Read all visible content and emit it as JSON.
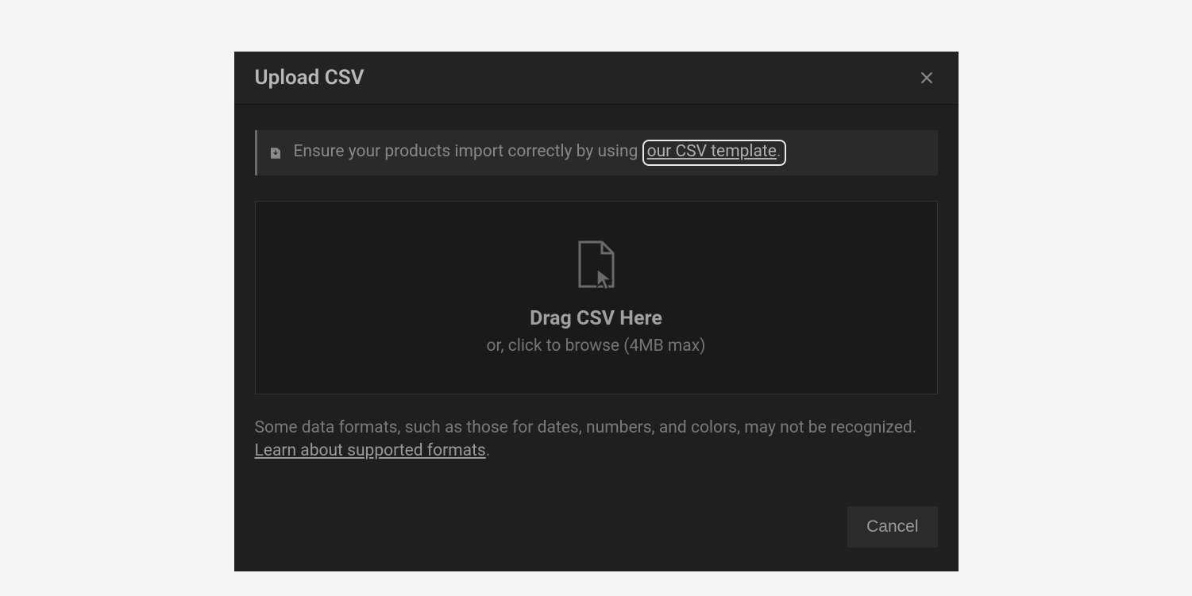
{
  "modal": {
    "title": "Upload CSV",
    "info": {
      "text_before": "Ensure your products import correctly by using",
      "link_text": "our CSV template",
      "text_after": "."
    },
    "dropzone": {
      "main": "Drag CSV Here",
      "sub": "or, click to browse (4MB max)"
    },
    "footnote": {
      "text_before": "Some data formats, such as those for dates, numbers, and colors, may not be recognized. ",
      "link_text": "Learn about supported formats",
      "text_after": "."
    },
    "buttons": {
      "cancel": "Cancel"
    }
  }
}
